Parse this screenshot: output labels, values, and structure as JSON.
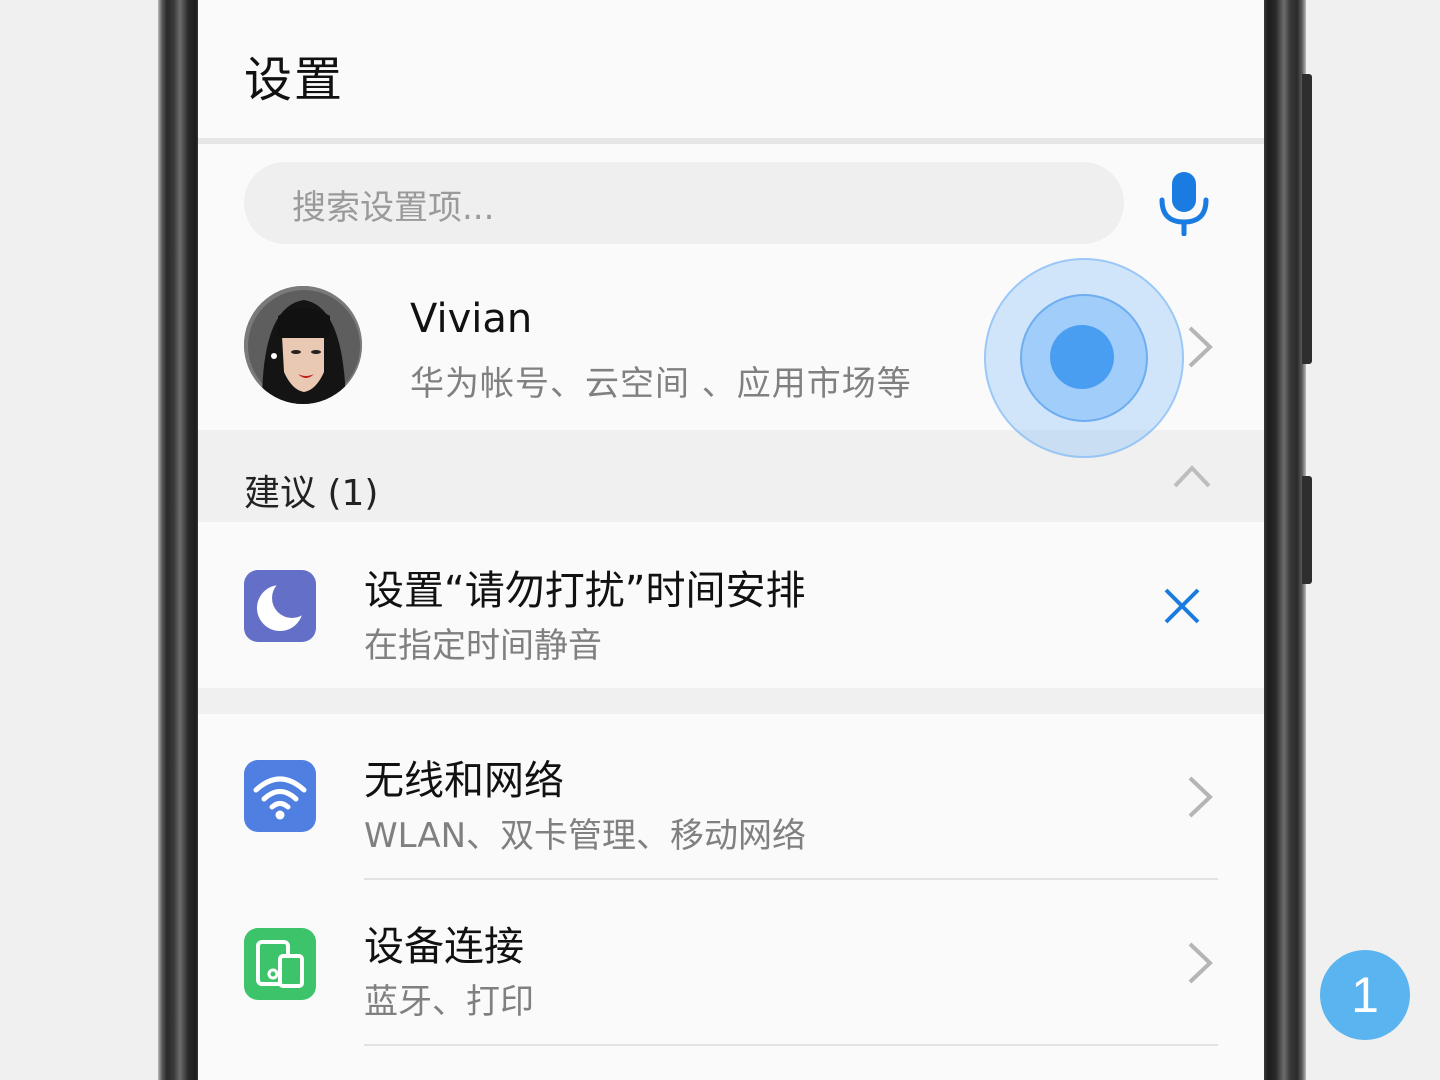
{
  "header": {
    "title": "设置"
  },
  "search": {
    "placeholder": "搜索设置项..."
  },
  "account": {
    "name": "Vivian",
    "description": "华为帐号、云空间 、应用市场等"
  },
  "suggestions": {
    "title": "建议 (1)",
    "item": {
      "title": "设置“请勿打扰”时间安排",
      "subtitle": "在指定时间静音",
      "icon": "moon-icon"
    }
  },
  "settings": [
    {
      "title": "无线和网络",
      "subtitle": "WLAN、双卡管理、移动网络",
      "icon": "wifi-icon",
      "color": "#4f7fe0"
    },
    {
      "title": "设备连接",
      "subtitle": "蓝牙、打印",
      "icon": "devices-icon",
      "color": "#3dc46a"
    }
  ],
  "colors": {
    "accent": "#1a7be0",
    "moon": "#6470c8",
    "touch": "#4a9ef2",
    "badge": "#5ab4f0"
  },
  "step_badge": "1"
}
